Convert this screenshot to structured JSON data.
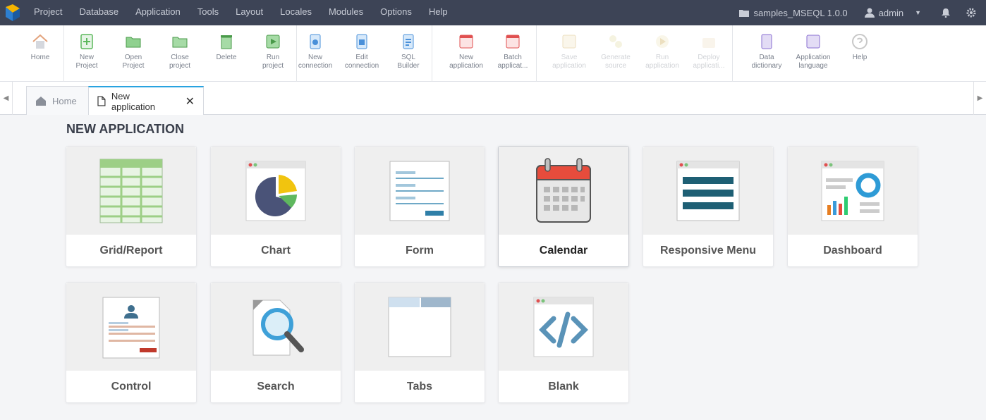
{
  "menubar": {
    "items": [
      "Project",
      "Database",
      "Application",
      "Tools",
      "Layout",
      "Locales",
      "Modules",
      "Options",
      "Help"
    ],
    "project": "samples_MSEQL 1.0.0",
    "user": "admin"
  },
  "toolbar": {
    "groups": [
      [
        {
          "label": "Home",
          "icon": "home-icon"
        }
      ],
      [
        {
          "label": "New\nProject",
          "icon": "new-project-icon"
        },
        {
          "label": "Open\nProject",
          "icon": "open-project-icon"
        },
        {
          "label": "Close\nproject",
          "icon": "close-project-icon"
        },
        {
          "label": "Delete",
          "icon": "delete-icon"
        },
        {
          "label": "Run\nproject",
          "icon": "run-project-icon"
        }
      ],
      [
        {
          "label": "New\nconnection",
          "icon": "new-connection-icon"
        },
        {
          "label": "Edit\nconnection",
          "icon": "edit-connection-icon"
        },
        {
          "label": "SQL\nBuilder",
          "icon": "sql-builder-icon"
        }
      ],
      [
        {
          "label": "New\napplication",
          "icon": "new-application-icon"
        },
        {
          "label": "Batch\napplicat...",
          "icon": "batch-application-icon"
        }
      ],
      [
        {
          "label": "Save\napplication",
          "icon": "save-application-icon",
          "disabled": true
        },
        {
          "label": "Generate\nsource",
          "icon": "generate-source-icon",
          "disabled": true
        },
        {
          "label": "Run\napplication",
          "icon": "run-application-icon",
          "disabled": true
        },
        {
          "label": "Deploy\napplicati...",
          "icon": "deploy-application-icon",
          "disabled": true
        }
      ],
      [
        {
          "label": "Data\ndictionary",
          "icon": "data-dictionary-icon"
        },
        {
          "label": "Application\nlanguage",
          "icon": "application-language-icon"
        },
        {
          "label": "Help",
          "icon": "help-icon"
        }
      ]
    ]
  },
  "tabs": [
    {
      "label": "Home",
      "icon": "home-icon",
      "active": false
    },
    {
      "label": "New application",
      "icon": "document-icon",
      "active": true
    }
  ],
  "page": {
    "title": "NEW APPLICATION",
    "cards": [
      {
        "label": "Grid/Report",
        "icon": "grid-report-icon"
      },
      {
        "label": "Chart",
        "icon": "chart-icon"
      },
      {
        "label": "Form",
        "icon": "form-icon"
      },
      {
        "label": "Calendar",
        "icon": "calendar-icon"
      },
      {
        "label": "Responsive Menu",
        "icon": "responsive-menu-icon"
      },
      {
        "label": "Dashboard",
        "icon": "dashboard-icon"
      },
      {
        "label": "Control",
        "icon": "control-icon"
      },
      {
        "label": "Search",
        "icon": "search-icon"
      },
      {
        "label": "Tabs",
        "icon": "tabs-icon"
      },
      {
        "label": "Blank",
        "icon": "blank-icon"
      }
    ]
  }
}
